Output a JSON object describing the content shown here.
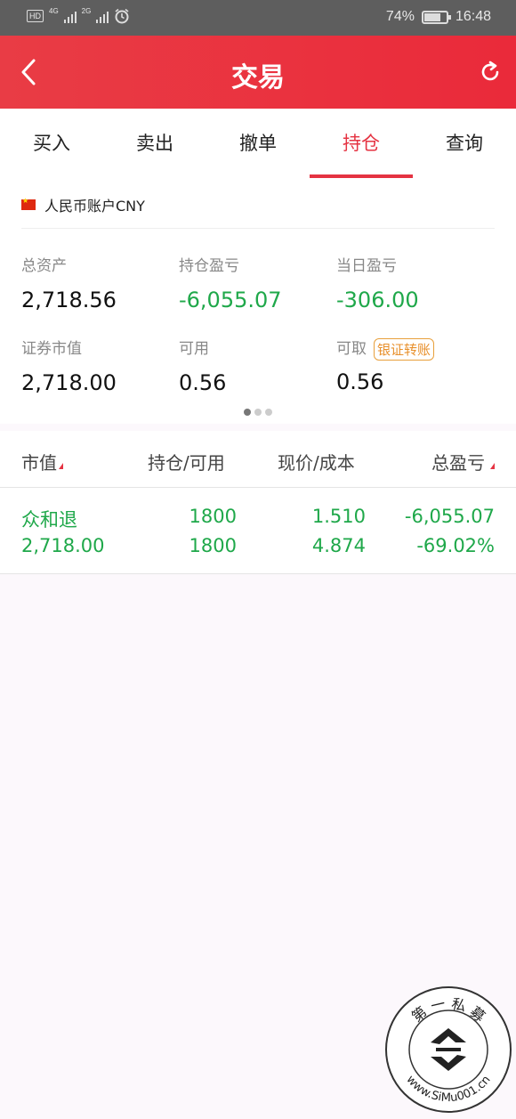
{
  "status_bar": {
    "hd": "HD",
    "net1": "4G",
    "net2": "2G",
    "battery": "74%",
    "battery_level": 0.74,
    "time": "16:48"
  },
  "header": {
    "title": "交易"
  },
  "tabs": [
    {
      "label": "买入",
      "active": false
    },
    {
      "label": "卖出",
      "active": false
    },
    {
      "label": "撤单",
      "active": false
    },
    {
      "label": "持仓",
      "active": true
    },
    {
      "label": "查询",
      "active": false
    }
  ],
  "account": {
    "name": "人民币账户CNY",
    "total_assets_label": "总资产",
    "total_assets": "2,718.56",
    "position_pl_label": "持仓盈亏",
    "position_pl": "-6,055.07",
    "daily_pl_label": "当日盈亏",
    "daily_pl": "-306.00",
    "market_value_label": "证券市值",
    "market_value": "2,718.00",
    "available_label": "可用",
    "available": "0.56",
    "withdrawable_label": "可取",
    "withdrawable": "0.56",
    "transfer_button": "银证转账"
  },
  "table": {
    "headers": [
      "市值",
      "持仓/可用",
      "现价/成本",
      "总盈亏"
    ],
    "rows": [
      {
        "name": "众和退",
        "market_value": "2,718.00",
        "position": "1800",
        "available": "1800",
        "price": "1.510",
        "cost": "4.874",
        "total_pl": "-6,055.07",
        "total_pl_pct": "-69.02%"
      }
    ]
  },
  "watermark": {
    "top_text": "第 一 私 募",
    "bottom_text": "www.SiMu001.cn"
  },
  "colors": {
    "brand_red": "#e93c45",
    "gain_loss_green": "#1fa84a",
    "badge_orange": "#e8902c"
  }
}
